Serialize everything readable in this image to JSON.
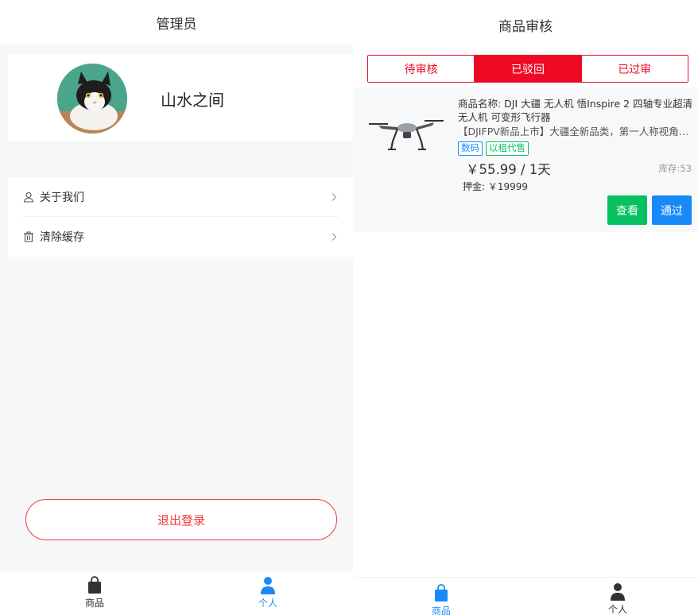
{
  "left": {
    "title": "管理员",
    "profile": {
      "username": "山水之间"
    },
    "menu": [
      {
        "label": "关于我们",
        "icon": "user-icon"
      },
      {
        "label": "清除缓存",
        "icon": "trash-icon"
      }
    ],
    "logout_label": "退出登录",
    "tabbar": [
      {
        "label": "商品",
        "icon": "bag-icon",
        "active": false
      },
      {
        "label": "个人",
        "icon": "person-icon",
        "active": true
      }
    ]
  },
  "right": {
    "title": "商品审核",
    "segments": [
      {
        "label": "待审核",
        "active": false
      },
      {
        "label": "已驳回",
        "active": true
      },
      {
        "label": "已过审",
        "active": false
      }
    ],
    "product": {
      "name": "商品名称: DJI 大疆 无人机 悟Inspire 2 四轴专业超清无人机 可变形飞行器",
      "description": "【DJIFPV新品上市】大疆全新品类，第一人称视角沉浸式飞行体验",
      "tags": [
        "数码",
        "以租代售"
      ],
      "price": "￥55.99 / 1天",
      "stock": "库存:53",
      "deposit": "押金: ￥19999",
      "view_label": "查看",
      "pass_label": "通过"
    },
    "tabbar": [
      {
        "label": "商品",
        "icon": "bag-icon",
        "active": true
      },
      {
        "label": "个人",
        "icon": "person-icon",
        "active": false
      }
    ]
  },
  "colors": {
    "accent_red": "#ee0a24",
    "logout_red": "#ee3a3a",
    "green": "#07c160",
    "blue": "#1989fa",
    "tab_active": "#1989fa",
    "tab_inactive": "#323233"
  }
}
